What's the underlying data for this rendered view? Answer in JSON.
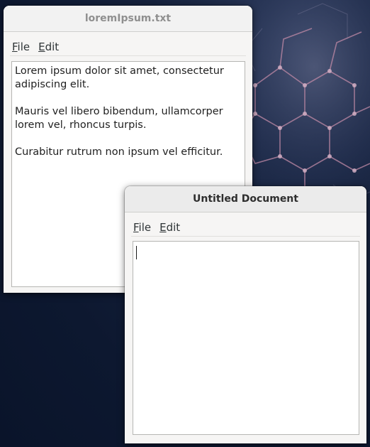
{
  "windows": {
    "back": {
      "title": "loremIpsum.txt",
      "menu": [
        {
          "mnemonic": "F",
          "rest": "ile"
        },
        {
          "mnemonic": "E",
          "rest": "dit"
        }
      ],
      "paragraphs": [
        "Lorem ipsum dolor sit amet, consectetur adipiscing elit.",
        "Mauris vel libero bibendum, ullamcorper lorem vel, rhoncus turpis.",
        "Curabitur rutrum non ipsum vel efficitur."
      ]
    },
    "front": {
      "title": "Untitled Document",
      "menu": [
        {
          "mnemonic": "F",
          "rest": "ile"
        },
        {
          "mnemonic": "E",
          "rest": "dit"
        }
      ],
      "content": ""
    }
  }
}
